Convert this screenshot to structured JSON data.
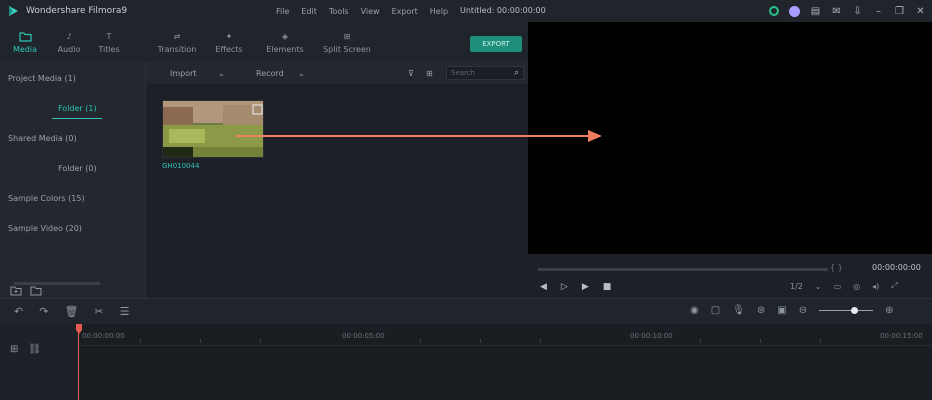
{
  "app": {
    "name": "Wondershare Filmora9",
    "document_title": "Untitled: 00:00:00:00"
  },
  "menu": [
    "File",
    "Edit",
    "Tools",
    "View",
    "Export",
    "Help"
  ],
  "tabs": [
    {
      "label": "Media",
      "icon": "folder-icon",
      "active": true
    },
    {
      "label": "Audio",
      "icon": "music-note-icon",
      "active": false
    },
    {
      "label": "Titles",
      "icon": "text-icon",
      "active": false
    },
    {
      "label": "Transition",
      "icon": "transition-icon",
      "active": false
    },
    {
      "label": "Effects",
      "icon": "effects-icon",
      "active": false
    },
    {
      "label": "Elements",
      "icon": "elements-icon",
      "active": false
    },
    {
      "label": "Split Screen",
      "icon": "split-screen-icon",
      "active": false
    }
  ],
  "export_label": "EXPORT",
  "sidebar": {
    "items": [
      {
        "label": "Project Media (1)",
        "sub": false,
        "active": false
      },
      {
        "label": "Folder (1)",
        "sub": true,
        "active": true
      },
      {
        "label": "Shared Media (0)",
        "sub": false,
        "active": false
      },
      {
        "label": "Folder (0)",
        "sub": true,
        "active": false
      },
      {
        "label": "Sample Colors (15)",
        "sub": false,
        "active": false
      },
      {
        "label": "Sample Video (20)",
        "sub": false,
        "active": false
      }
    ]
  },
  "media_toolbar": {
    "import_label": "Import",
    "record_label": "Record",
    "search_placeholder": "Search"
  },
  "media_item": {
    "name": "GH010044"
  },
  "preview": {
    "timecode": "00:00:00:00",
    "quality": "1/2"
  },
  "timeline": {
    "ruler": [
      "00:00:00:00",
      "00:00:05:00",
      "00:00:10:00",
      "00:00:15:00"
    ]
  },
  "colors": {
    "accent": "#2ec4b6",
    "playhead": "#e35b4f",
    "arrow": "#f07e5f"
  }
}
